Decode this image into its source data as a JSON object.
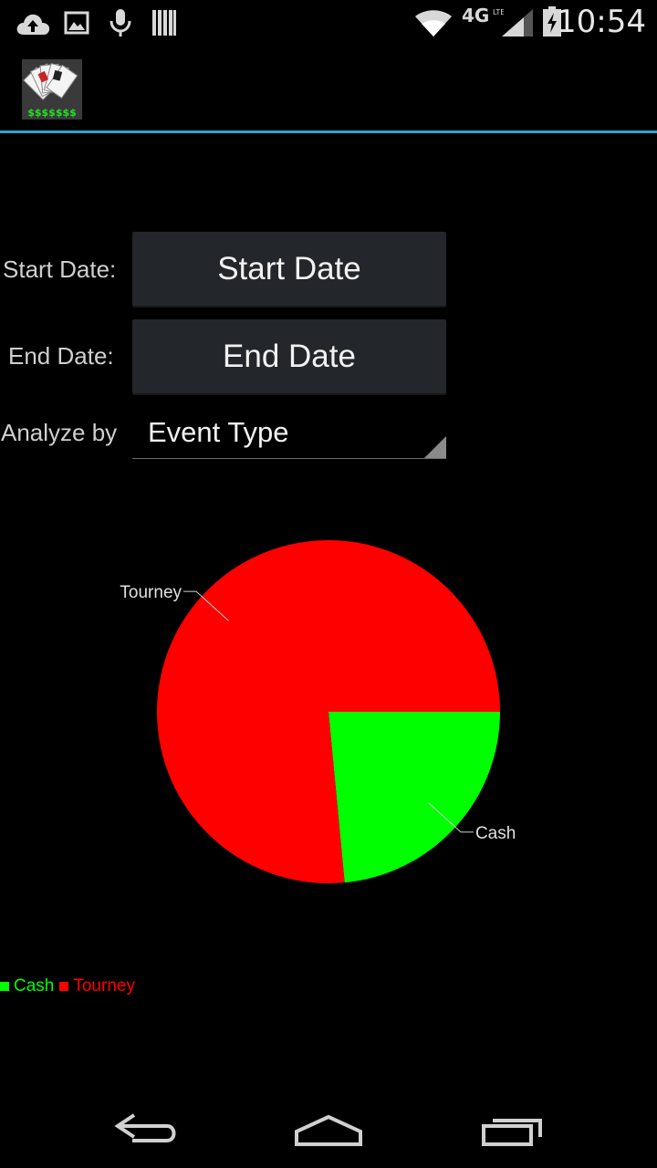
{
  "status_bar": {
    "time": "10:54",
    "network": "4G LTE",
    "icons": [
      "cloud-upload-icon",
      "image-icon",
      "microphone-icon",
      "barcode-icon",
      "wifi-icon",
      "signal-icon",
      "battery-charging-icon"
    ]
  },
  "action_bar": {
    "logo_icon": "playing-cards-logo-icon",
    "logo_text": "$$$$$$$"
  },
  "form": {
    "start_date_label": "Start Date:",
    "start_date_button": "Start Date",
    "end_date_label": "End Date:",
    "end_date_button": "End Date",
    "analyze_label": "Analyze by",
    "analyze_value": "Event Type"
  },
  "chart_data": {
    "type": "pie",
    "categories": [
      "Cash",
      "Tourney"
    ],
    "values": [
      23.5,
      76.5
    ],
    "colors": [
      "#00ff00",
      "#ff0000"
    ],
    "legend_position": "bottom-left"
  },
  "legend": [
    {
      "label": "Cash",
      "color": "#00ff00"
    },
    {
      "label": "Tourney",
      "color": "#ff0000"
    }
  ],
  "nav_bar": {
    "icons": [
      "back-icon",
      "home-icon",
      "recent-apps-icon"
    ]
  },
  "colors": {
    "accent": "#33a0d4",
    "button_bg": "#23272b"
  }
}
